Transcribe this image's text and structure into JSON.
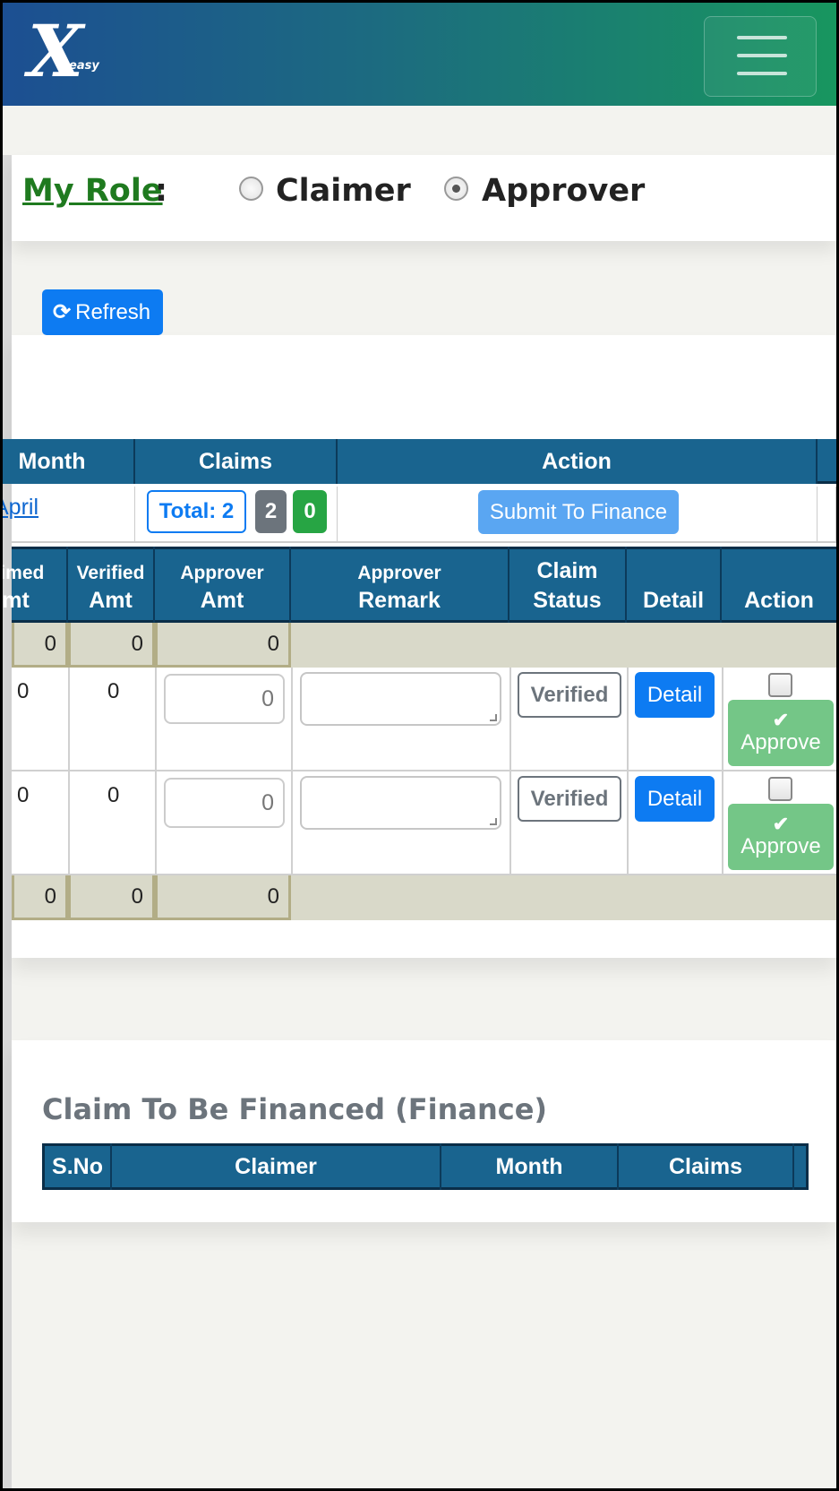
{
  "header": {
    "logo_main": "X",
    "logo_sub": "easy"
  },
  "role": {
    "label": "My Role",
    "colon": ":",
    "options": [
      "Claimer",
      "Approver"
    ],
    "selected": "Approver"
  },
  "refresh": {
    "icon": "refresh-icon",
    "label": "Refresh"
  },
  "summary": {
    "headers": {
      "month": "Month",
      "claims": "Claims",
      "action": "Action"
    },
    "row": {
      "month": "April",
      "total": "Total: 2",
      "count_grey": "2",
      "count_green": "0",
      "action": "Submit To Finance"
    }
  },
  "detail": {
    "headers": {
      "claimed": {
        "l1": "Claimed",
        "l2": "Amt"
      },
      "verified": {
        "l1": "Verified",
        "l2": "Amt"
      },
      "approver_amt": {
        "l1": "Approver",
        "l2": "Amt"
      },
      "approver_remark": {
        "l1": "Approver",
        "l2": "Remark"
      },
      "claim_status": {
        "l1": "Claim",
        "l2": "Status"
      },
      "detail": "Detail",
      "action": "Action"
    },
    "top_totals": {
      "claimed": "0",
      "verified": "0",
      "approver": "0"
    },
    "rows": [
      {
        "claimed": "0",
        "verified": "0",
        "approver_amt": "0",
        "remark": "",
        "status": "Verified",
        "detail": "Detail",
        "approve": "Approve"
      },
      {
        "claimed": "0",
        "verified": "0",
        "approver_amt": "0",
        "remark": "",
        "status": "Verified",
        "detail": "Detail",
        "approve": "Approve"
      }
    ],
    "bottom_totals": {
      "claimed": "0",
      "verified": "0",
      "approver": "0"
    }
  },
  "finance": {
    "title": "Claim To Be Financed (Finance)",
    "headers": [
      "S.No",
      "Claimer",
      "Month",
      "Claims"
    ]
  },
  "colors": {
    "header_start": "#1c4f92",
    "header_end": "#18965f",
    "table_head": "#19648f",
    "primary": "#0d7bf2",
    "success": "#27a544"
  }
}
